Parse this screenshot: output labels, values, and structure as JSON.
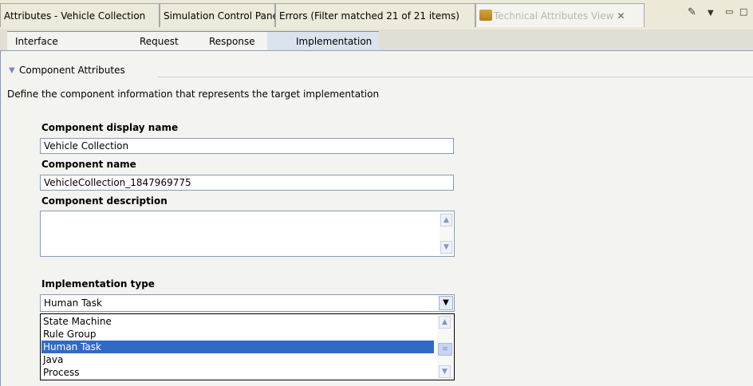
{
  "view_tabs": [
    {
      "label": "Attributes - Vehicle Collection",
      "active": false
    },
    {
      "label": "Simulation Control Panel",
      "active": false
    },
    {
      "label": "Errors (Filter matched 21 of 21 items)",
      "active": false
    },
    {
      "label": "Technical Attributes View",
      "active": true,
      "icon": "view-icon",
      "closable": true
    }
  ],
  "view_toolbar": {
    "menu_icon": "edit-icon",
    "dropdown_icon": "chevron-down-icon",
    "minimize_icon": "minimize-icon",
    "maximize_icon": "maximize-icon"
  },
  "page_tabs": [
    {
      "label": "Interface",
      "active": false
    },
    {
      "label": "Request",
      "active": false
    },
    {
      "label": "Response",
      "active": false
    },
    {
      "label": "Implementation",
      "active": true
    }
  ],
  "section": {
    "title": "Component Attributes",
    "description": "Define the component information that represents the target implementation"
  },
  "form": {
    "display_name_label": "Component display name",
    "display_name_value": "Vehicle Collection",
    "name_label": "Component name",
    "name_value": "VehicleCollection_1847969775",
    "description_label": "Component description",
    "description_value": "",
    "implementation_label": "Implementation type",
    "implementation_value": "Human Task",
    "implementation_options": [
      "State Machine",
      "Rule Group",
      "Human Task",
      "Java",
      "Process"
    ],
    "selected_index": 2
  },
  "colors": {
    "selection": "#316ac5",
    "active_page_tab": "#dbe3ee",
    "tab_border": "#8ea3c0"
  }
}
